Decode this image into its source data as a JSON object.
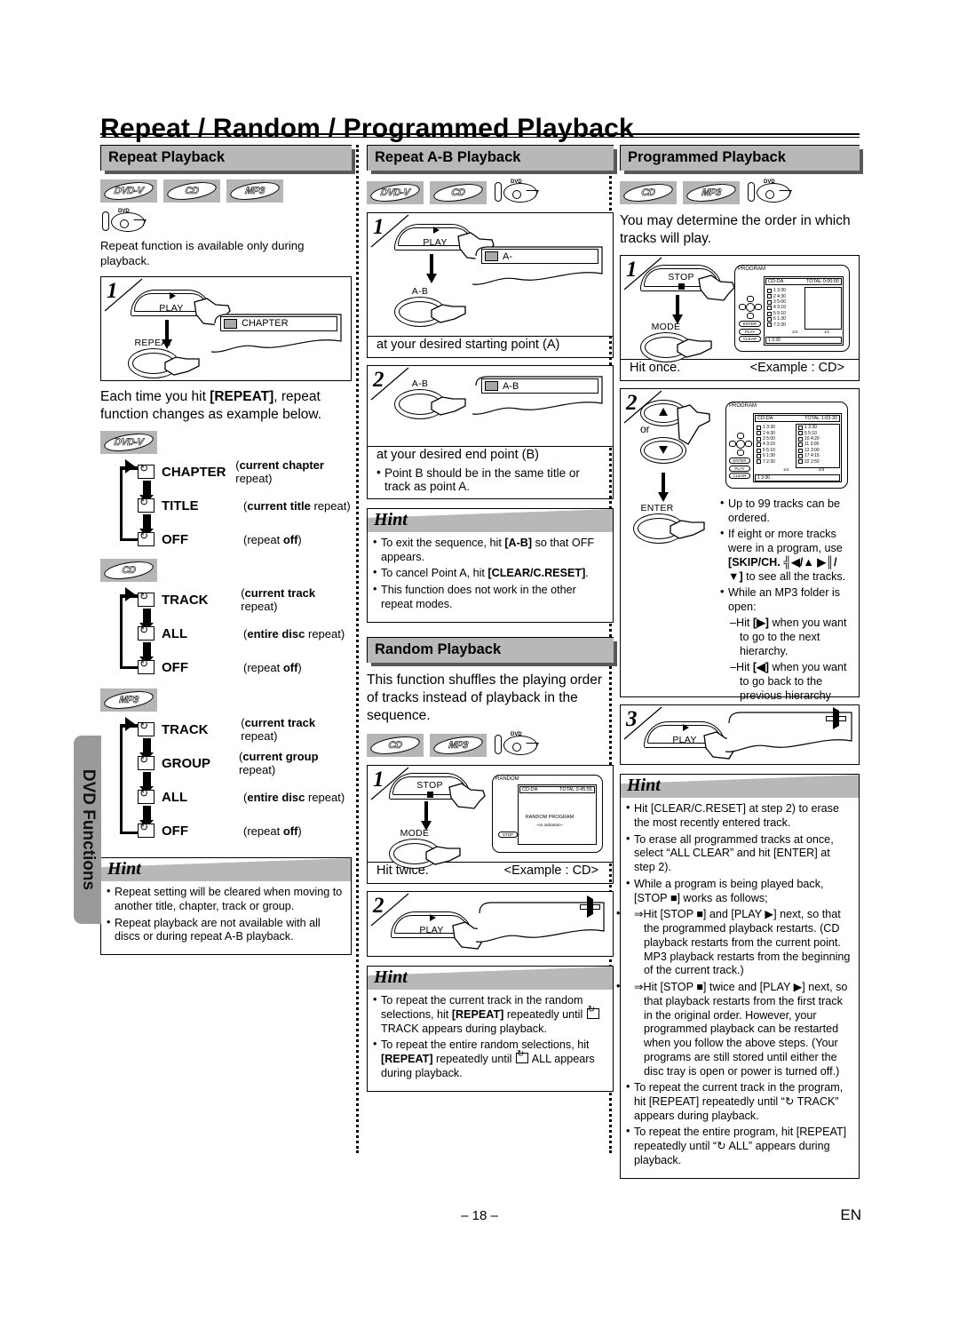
{
  "page": {
    "title": "Repeat / Random / Programmed Playback",
    "side_tab": "DVD Functions",
    "page_number": "– 18 –",
    "language_code": "EN"
  },
  "icons": {
    "dvdv": "DVD-V",
    "cd": "CD",
    "mp3": "MP3",
    "tray": "dvd-tray-icon"
  },
  "repeat_playback": {
    "heading": "Repeat Playback",
    "badges": [
      "DVD-V",
      "CD",
      "MP3"
    ],
    "intro": "Repeat function is available only during playback.",
    "step1": {
      "number": "1",
      "btn_play": "PLAY",
      "btn_repeat": "REPEAT",
      "osd_text": "CHAPTER"
    },
    "after_step": "Each time you hit [REPEAT], repeat function changes as example below.",
    "after_step_key": "[REPEAT]",
    "flows": [
      {
        "disc": "DVD-V",
        "items": [
          {
            "label": "CHAPTER",
            "desc_bold": "current chapter",
            "desc_rest": " repeat)",
            "desc_open": "("
          },
          {
            "label": "TITLE",
            "desc_bold": "current title",
            "desc_rest": " repeat)",
            "desc_open": "("
          },
          {
            "label": "OFF",
            "desc_bold": "off",
            "desc_rest": ")",
            "desc_open": "(repeat "
          }
        ]
      },
      {
        "disc": "CD",
        "items": [
          {
            "label": "TRACK",
            "desc_bold": "current track",
            "desc_rest": " repeat)",
            "desc_open": "("
          },
          {
            "label": "ALL",
            "desc_bold": "entire disc",
            "desc_rest": " repeat)",
            "desc_open": "("
          },
          {
            "label": "OFF",
            "desc_bold": "off",
            "desc_rest": ")",
            "desc_open": "(repeat "
          }
        ]
      },
      {
        "disc": "MP3",
        "items": [
          {
            "label": "TRACK",
            "desc_bold": "current track",
            "desc_rest": " repeat)",
            "desc_open": "("
          },
          {
            "label": "GROUP",
            "desc_bold": "current group",
            "desc_rest": " repeat)",
            "desc_open": "("
          },
          {
            "label": "ALL",
            "desc_bold": "entire disc",
            "desc_rest": " repeat)",
            "desc_open": "("
          },
          {
            "label": "OFF",
            "desc_bold": "off",
            "desc_rest": ")",
            "desc_open": "(repeat "
          }
        ]
      }
    ],
    "hint": {
      "title": "Hint",
      "items": [
        "Repeat setting will be cleared when moving to another title, chapter, track or group.",
        "Repeat playback are not available with all discs or during repeat A-B playback."
      ]
    }
  },
  "repeat_ab": {
    "heading": "Repeat A-B Playback",
    "badges": [
      "DVD-V",
      "CD"
    ],
    "step1": {
      "number": "1",
      "btn_play": "PLAY",
      "btn_ab": "A-B",
      "osd_text": "A-",
      "caption": "at your desired starting point (A)"
    },
    "step2": {
      "number": "2",
      "btn_ab": "A-B",
      "osd_text": "A-B",
      "caption": "at your desired end point (B)"
    },
    "note": "Point B should be in the same title or track as point A.",
    "hint": {
      "title": "Hint",
      "items": [
        {
          "pre": "To exit the sequence, hit ",
          "key": "[A-B]",
          "post": " so that OFF appears."
        },
        {
          "pre": "To cancel Point A, hit ",
          "key": "[CLEAR/C.RESET]",
          "post": "."
        },
        {
          "pre": "This function does not work in the other repeat modes.",
          "key": "",
          "post": ""
        }
      ]
    }
  },
  "random_playback": {
    "heading": "Random Playback",
    "intro": "This function shuffles the playing order of tracks instead of playback in the sequence.",
    "badges": [
      "CD",
      "MP3"
    ],
    "step1": {
      "number": "1",
      "btn_stop": "STOP",
      "btn_mode": "MODE",
      "caption": "Hit twice.",
      "example": "<Example : CD>",
      "osd": {
        "title": "RANDOM",
        "disc_type": "CD-DA",
        "total": "TOTAL 0:45:55",
        "line1": "RANDOM PROGRAM",
        "line2": "--no indication--",
        "pill": "STOP"
      }
    },
    "step2": {
      "number": "2",
      "btn_play": "PLAY",
      "osd_icon": "play-triangle"
    },
    "hint": {
      "title": "Hint",
      "items": [
        {
          "pre": "To repeat the current track in the random selections, hit ",
          "key": "[REPEAT]",
          "post": " repeatedly until ",
          "glyph": true,
          "tail": "TRACK appears during playback."
        },
        {
          "pre": "To repeat the entire random selections, hit ",
          "key": "[REPEAT]",
          "post": " repeatedly until ",
          "glyph": true,
          "tail": "ALL appears during playback."
        }
      ]
    }
  },
  "programmed_playback": {
    "heading": "Programmed Playback",
    "badges": [
      "CD",
      "MP3"
    ],
    "intro": "You may determine the order in which tracks will play.",
    "step1": {
      "number": "1",
      "btn_stop": "STOP",
      "btn_mode": "MODE",
      "caption": "Hit once.",
      "example": "<Example : CD>",
      "osd": {
        "title": "PROGRAM",
        "disc_type": "CD-DA",
        "total": "TOTAL 0:00:00",
        "tracks": [
          "1  3:30",
          "2  4:30",
          "3  5:00",
          "4  3:10",
          "5  5:10",
          "6  1:30",
          "7  2:30"
        ],
        "page_left": "1/4",
        "page_right": "1/1",
        "footer_track": "1   3:30",
        "btn_enter": "ENTER",
        "btn_play": "PLAY",
        "btn_clear": "CLEAR"
      }
    },
    "step2": {
      "number": "2",
      "or_label": "or",
      "btn_enter": "ENTER",
      "osd": {
        "title": "PROGRAM",
        "disc_type": "CD-DA",
        "total": "TOTAL 1:03:30",
        "tracks_left": [
          "1  3:30",
          "2  4:30",
          "3  5:00",
          "4  3:10",
          "5  5:10",
          "6  1:30",
          "7  2:30"
        ],
        "tracks_right": [
          "1   3:30",
          "5   5:10",
          "10  4:20",
          "11  3:00",
          "12  3:00",
          "17  4:15",
          "22  2:50"
        ],
        "page_left": "1/4",
        "page_right": "2/3",
        "footer_track": "1   3:30"
      },
      "notes": [
        {
          "text": "Up to 99 tracks can be ordered.",
          "key": ""
        },
        {
          "pre": "If eight or more tracks were in a program, use ",
          "key": "[SKIP/CH. ╣◀/▲ ▶║/▼]",
          "post": " to see all the tracks."
        },
        {
          "pre": "While an MP3 folder is open:",
          "key": "",
          "post": ""
        }
      ],
      "sub_notes": [
        {
          "pre": "–Hit ",
          "key": "[▶]",
          "post": " when you want to go to the next hierarchy."
        },
        {
          "pre": "–Hit ",
          "key": "[◀]",
          "post": " when you want to go back to the previous hierarchy (except for the top hierarchy)."
        }
      ]
    },
    "step3": {
      "number": "3",
      "btn_play": "PLAY",
      "osd_icon": "play-triangle"
    },
    "hint": {
      "title": "Hint",
      "items": [
        "Hit [CLEAR/C.RESET] at step 2) to erase the most recently entered track.",
        "To erase all programmed tracks at once, select “ALL CLEAR” and hit [ENTER] at step 2).",
        "While a program is being played back, [STOP ■] works as follows;",
        "⇒Hit [STOP ■] and [PLAY ▶] next, so that the programmed playback restarts. (CD playback restarts from the current point. MP3 playback restarts from the beginning of the current track.)",
        "⇒Hit [STOP ■] twice and [PLAY ▶] next, so that playback restarts from the first track in the original order. However, your programmed playback can be restarted when you follow the above steps. (Your programs are still stored until either the disc tray is open or power is turned off.)",
        "To repeat the current track in the program, hit [REPEAT] repeatedly until “↻ TRACK” appears during playback.",
        "To repeat the entire program, hit [REPEAT] repeatedly until “↻ ALL” appears during playback."
      ]
    }
  }
}
